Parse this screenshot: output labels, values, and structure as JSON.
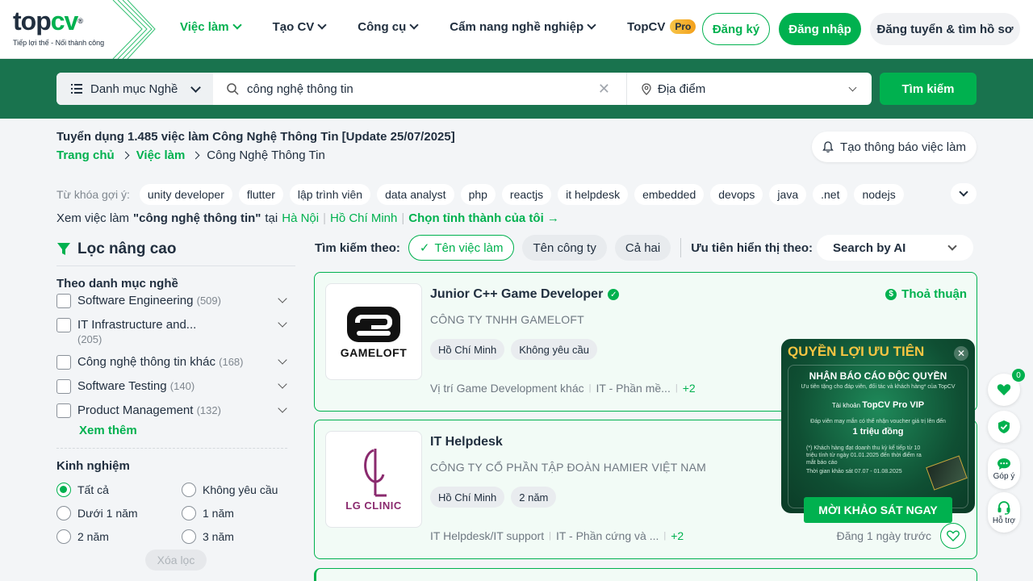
{
  "header": {
    "logo_brand_top": "top",
    "logo_brand_cv": "cv",
    "logo_tagline": "Tiếp lợi thế - Nối thành công",
    "nav": [
      {
        "label": "Việc làm"
      },
      {
        "label": "Tạo CV"
      },
      {
        "label": "Công cụ"
      },
      {
        "label": "Cẩm nang nghề nghiệp"
      },
      {
        "label": "TopCV"
      }
    ],
    "pro_badge": "Pro",
    "register": "Đăng ký",
    "login": "Đăng nhập",
    "employer": "Đăng tuyển & tìm hồ sơ"
  },
  "search": {
    "category": "Danh mục Nghề",
    "keyword": "công nghệ thông tin",
    "location_placeholder": "Địa điểm",
    "button": "Tìm kiếm"
  },
  "page": {
    "title": "Tuyển dụng 1.485 việc làm Công Nghệ Thông Tin [Update 25/07/2025]",
    "breadcrumb": [
      "Trang chủ",
      "Việc làm",
      "Công Nghệ Thông Tin"
    ],
    "alert_button": "Tạo thông báo việc làm",
    "suggest_label": "Từ khóa gợi ý:",
    "suggest_keywords": [
      "unity developer",
      "flutter",
      "lập trình viên",
      "data analyst",
      "php",
      "reactjs",
      "it helpdesk",
      "embedded",
      "devops",
      "java",
      ".net",
      "nodejs"
    ],
    "see_jobs_prefix": "Xem việc làm",
    "see_jobs_keyword": "\"công nghệ thông tin\"",
    "see_jobs_at": "tại",
    "city_1": "Hà Nội",
    "city_2": "Hồ Chí Minh",
    "choose_city": "Chọn tỉnh thành của tôi →"
  },
  "filter": {
    "title": "Lọc nâng cao",
    "category_title": "Theo danh mục nghề",
    "categories": [
      {
        "label": "Software Engineering",
        "count": "(509)"
      },
      {
        "label": "IT Infrastructure and...",
        "count": "(205)"
      },
      {
        "label": "Công nghệ thông tin khác",
        "count": "(168)"
      },
      {
        "label": "Software Testing",
        "count": "(140)"
      },
      {
        "label": "Product Management",
        "count": "(132)"
      }
    ],
    "see_more": "Xem thêm",
    "experience_title": "Kinh nghiệm",
    "experience": [
      "Tất cả",
      "Không yêu cầu",
      "Dưới 1 năm",
      "1 năm",
      "2 năm",
      "3 năm"
    ],
    "clear": "Xóa lọc"
  },
  "searchby": {
    "label": "Tìm kiếm theo:",
    "options": [
      "Tên việc làm",
      "Tên công ty",
      "Cả hai"
    ],
    "priority_label": "Ưu tiên hiển thị theo:",
    "priority_value": "Search by AI"
  },
  "jobs": [
    {
      "title": "Junior C++ Game Developer",
      "company": "CÔNG TY TNHH GAMELOFT",
      "logo_text": "GAMELOFT",
      "tags": [
        "Hồ Chí Minh",
        "Không yêu cầu"
      ],
      "meta_1": "Vị trí Game Development khác",
      "meta_2": "IT - Phần mề...",
      "meta_more": "+2",
      "salary": "Thoả thuận"
    },
    {
      "title": "IT Helpdesk",
      "company": "CÔNG TY CỔ PHẦN TẬP ĐOÀN HAMIER VIỆT NAM",
      "logo_text": "LG CLINIC",
      "tags": [
        "Hồ Chí Minh",
        "2 năm"
      ],
      "meta_1": "IT Helpdesk/IT support",
      "meta_2": "IT - Phần cứng và ...",
      "meta_more": "+2",
      "posted": "Đăng 1 ngày trước"
    }
  ],
  "promo": {
    "title": "QUYỀN LỢI ƯU TIÊN",
    "heading": "NHẬN BÁO CÁO ĐỘC QUYỀN",
    "sub": "Ưu tiên tặng cho đáp viên, đối tác và khách hàng* của TopCV",
    "account_prefix": "Tài khoản",
    "account": "TopCV Pro VIP",
    "voucher_line": "Đáp viên may mắn có thể nhận voucher giá trị lên đến",
    "voucher_value": "1 triệu đồng",
    "fine_print": "(*) Khách hàng đạt doanh thu kỳ kế tiếp từ 10 triệu tính từ ngày 01.01.2025 đến thời điểm ra mắt báo cáo",
    "period": "Thời gian khảo sát 07.07 - 01.08.2025",
    "cta": "MỜI KHẢO SÁT NGAY"
  },
  "floating": {
    "heart_count": "0",
    "feedback": "Góp ý",
    "support": "Hỗ trợ"
  },
  "colors": {
    "brand": "#00b14f",
    "band": "#19734e"
  }
}
